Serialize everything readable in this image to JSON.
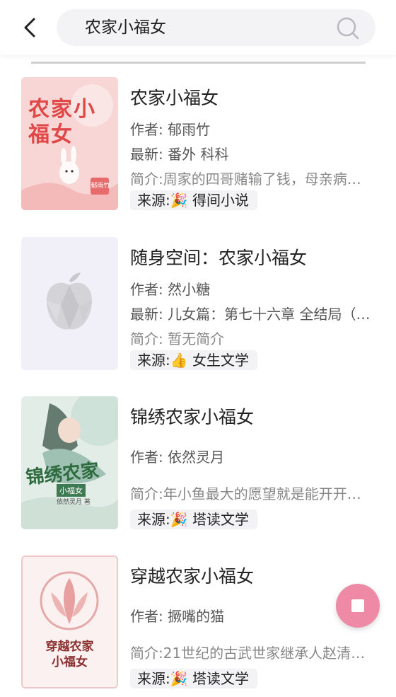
{
  "header": {
    "search_value": "农家小福女"
  },
  "books": [
    {
      "title": "农家小福女",
      "author": "作者: 郁雨竹",
      "latest": "最新: 番外 科科",
      "intro": "简介:周家的四哥赌输了钱，母亲病…",
      "source": "来源:🎉 得间小说",
      "cover_text": "农家小福女",
      "cover_author": "郁雨竹"
    },
    {
      "title": "随身空间：农家小福女",
      "author": "作者: 然小糖",
      "latest": "最新: 儿女篇：第七十六章 全结局（…",
      "intro": "简介: 暂无简介",
      "source": "来源:👍 女生文学"
    },
    {
      "title": "锦绣农家小福女",
      "author": "作者: 依然灵月",
      "intro": "简介:年小鱼最大的愿望就是能开开…",
      "source": "来源:🎉 塔读文学",
      "cover_text": "锦绣农家",
      "cover_sub": "小福女",
      "cover_author": "依然灵月 著"
    },
    {
      "title": "穿越农家小福女",
      "author": "作者: 撅嘴的猫",
      "intro": "简介:21世纪的古武世家继承人赵清…",
      "source": "来源:🎉 塔读文学",
      "cover_text": "穿越农家",
      "cover_sub": "小福女"
    }
  ]
}
